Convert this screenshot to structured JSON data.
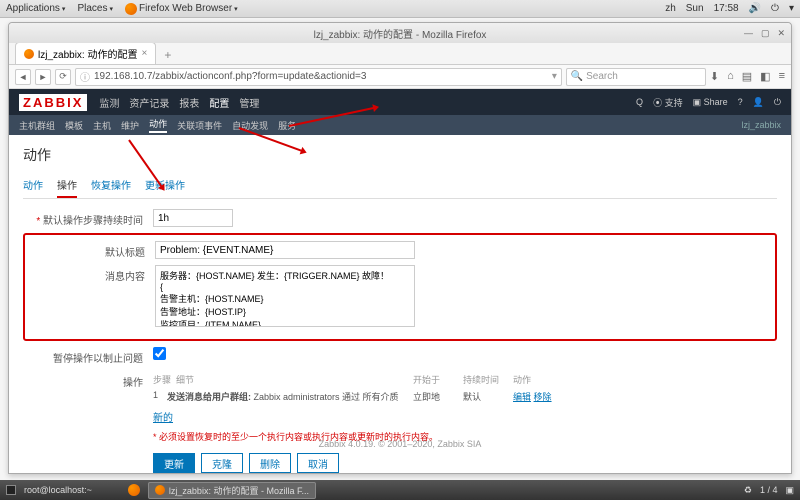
{
  "desktop": {
    "apps": "Applications",
    "places": "Places",
    "browser": "Firefox Web Browser",
    "lang": "zh",
    "day": "Sun",
    "time": "17:58"
  },
  "browser": {
    "window_title": "lzj_zabbix: 动作的配置 - Mozilla Firefox",
    "tab_title": "lzj_zabbix: 动作的配置",
    "url": "192.168.10.7/zabbix/actionconf.php?form=update&actionid=3",
    "search_placeholder": "Search"
  },
  "zabbix": {
    "logo": "ZABBIX",
    "menu": [
      "监测",
      "资产记录",
      "报表",
      "配置",
      "管理"
    ],
    "top_right": {
      "support": "支持",
      "share": "Share"
    },
    "submenu": [
      "主机群组",
      "模板",
      "主机",
      "维护",
      "动作",
      "关联项事件",
      "自动发现",
      "服务"
    ],
    "sub_right": "lzj_zabbix"
  },
  "page": {
    "title": "动作",
    "tabs": [
      "动作",
      "操作",
      "恢复操作",
      "更新操作"
    ]
  },
  "form": {
    "step_duration_label": "默认操作步骤持续时间",
    "step_duration_value": "1h",
    "subject_label": "默认标题",
    "subject_value": "Problem: {EVENT.NAME}",
    "message_label": "消息内容",
    "message_value": "服务器：{HOST.NAME} 发生：{TRIGGER.NAME} 故障！\n{\n告警主机：{HOST.NAME}\n告警地址：{HOST.IP}\n监控项目：{ITEM.NAME}\n监控取值：{ITEM.LASTVALUE}\n告警等级：{TRIGGER.SEVERITY}",
    "pause_label": "暂停操作以制止问题",
    "ops_label": "操作",
    "ops_headers": {
      "step": "步骤",
      "detail": "细节",
      "start": "开始于",
      "duration": "持续时间",
      "action": "动作"
    },
    "ops_row": {
      "num": "1",
      "text_a": "发送消息给用户群组:",
      "text_b": "Zabbix administrators 通过 所有介质",
      "start": "立即地",
      "duration": "默认",
      "edit": "编辑",
      "remove": "移除"
    },
    "new_link": "新的",
    "hint": "* 必须设置恢复时的至少一个执行内容或执行内容或更新时的执行内容。",
    "buttons": {
      "update": "更新",
      "clone": "克隆",
      "delete": "删除",
      "cancel": "取消"
    }
  },
  "footer": "Zabbix 4.0.19. © 2001–2020, Zabbix SIA",
  "taskbar": {
    "terminal": "root@localhost:~",
    "task": "lzj_zabbix: 动作的配置 - Mozilla F...",
    "pages": "1 / 4",
    "tray": "♻"
  }
}
